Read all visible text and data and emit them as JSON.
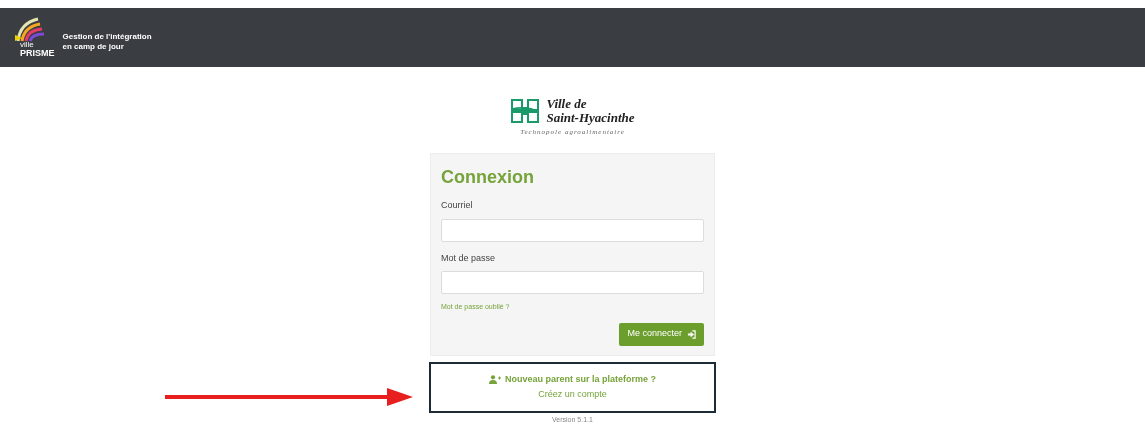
{
  "header": {
    "brand_small": "ville",
    "brand": "PRISME",
    "title_line1": "Gestion de l'intégration",
    "title_line2": "en camp de jour"
  },
  "city_logo": {
    "line1": "Ville de",
    "line2": "Saint-Hyacinthe",
    "tagline": "Technopole agroalimentaire"
  },
  "login": {
    "title": "Connexion",
    "email_label": "Courriel",
    "password_label": "Mot de passe",
    "forgot_link": "Mot de passe oublié ?",
    "submit": "Me connecter"
  },
  "signup": {
    "question": "Nouveau parent sur la plateforme ?",
    "link": "Créez un compte"
  },
  "version": "Version 5.1.1"
}
